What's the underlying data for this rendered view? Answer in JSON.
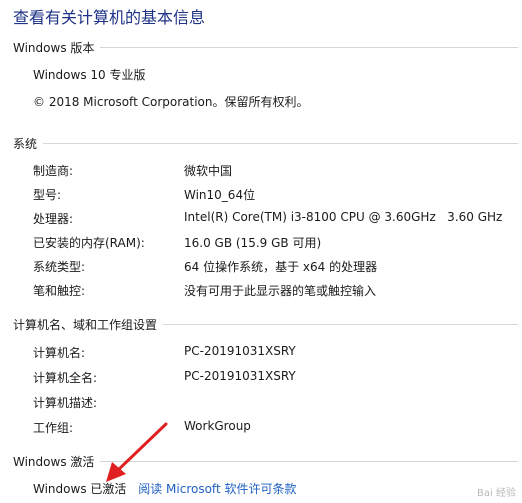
{
  "page_title": "查看有关计算机的基本信息",
  "edition": {
    "header": "Windows 版本",
    "name": "Windows 10 专业版",
    "copyright": "© 2018 Microsoft Corporation。保留所有权利。"
  },
  "system": {
    "header": "系统",
    "rows": [
      {
        "label": "制造商:",
        "value": "微软中国"
      },
      {
        "label": "型号:",
        "value": "Win10_64位"
      },
      {
        "label": "处理器:",
        "value": "Intel(R) Core(TM) i3-8100 CPU @ 3.60GHz   3.60 GHz"
      },
      {
        "label": "已安装的内存(RAM):",
        "value": "16.0 GB (15.9 GB 可用)"
      },
      {
        "label": "系统类型:",
        "value": "64 位操作系统，基于 x64 的处理器"
      },
      {
        "label": "笔和触控:",
        "value": "没有可用于此显示器的笔或触控输入"
      }
    ]
  },
  "computer_name": {
    "header": "计算机名、域和工作组设置",
    "rows": [
      {
        "label": "计算机名:",
        "value": "PC-20191031XSRY"
      },
      {
        "label": "计算机全名:",
        "value": "PC-20191031XSRY"
      },
      {
        "label": "计算机描述:",
        "value": ""
      },
      {
        "label": "工作组:",
        "value": "WorkGroup"
      }
    ]
  },
  "activation": {
    "header": "Windows 激活",
    "status": "Windows 已激活",
    "license_link": "阅读 Microsoft 软件许可条款"
  },
  "watermark": "Bai 经验",
  "colors": {
    "title": "#1e3287",
    "link": "#1e5fc2",
    "arrow": "#e02020"
  }
}
